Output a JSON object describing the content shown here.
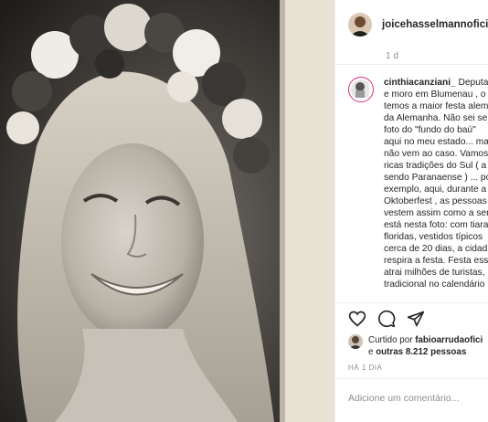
{
  "post": {
    "author": "joicehasselmannoficial",
    "time": "1 d",
    "photo_icon": "vintage-portrait-photo"
  },
  "comment": {
    "username": "cinthiacanziani_",
    "lines": [
      " Deputad",
      "e moro em Blumenau , o",
      "temos a maior festa alem",
      "da Alemanha. Não sei se",
      "foto do \"fundo do baú\"",
      "aqui no meu estado... ma",
      "não vem ao caso. Vamos",
      "ricas tradições do Sul ( a",
      "sendo Paranaense ) ... po",
      "exemplo, aqui, durante a",
      "Oktoberfest , as pessoas",
      "vestem assim como a ser",
      "está nesta foto: com tiara",
      "floridas, vestidos típicos",
      "cerca de 20 dias, a cidad",
      "respira a festa. Festa essa",
      "atrai milhões de turistas,",
      "tradicional no calendário"
    ]
  },
  "actions": {
    "like_icon": "heart-icon",
    "comment_icon": "comment-icon",
    "share_icon": "share-icon"
  },
  "likes": {
    "prefix": "Curtido por ",
    "user": "fabioarrudaofici",
    "connector": "e",
    "others": "outras 8.212 pessoas"
  },
  "ago": "HÁ 1 DIA",
  "input": {
    "placeholder": "Adicione um comentário..."
  },
  "colors": {
    "verified": "#3897f0",
    "story_ring": "#d82f7e",
    "muted": "#8e8e8e"
  }
}
